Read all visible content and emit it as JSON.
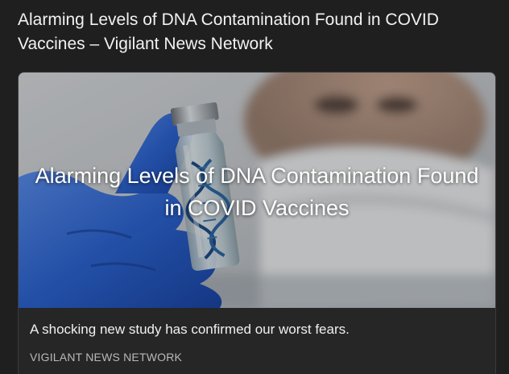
{
  "page": {
    "title": "Alarming Levels of DNA Contamination Found in COVID Vaccines – Vigilant News Network"
  },
  "card": {
    "image_title": "Alarming Levels of DNA Contamination Found in COVID Vaccines",
    "description": "A shocking new study has confirmed our worst fears.",
    "source": "VIGILANT NEWS NETWORK"
  },
  "colors": {
    "background": "#1f1f1f",
    "card_background": "#262626",
    "glove_blue": "#2d66d6"
  }
}
